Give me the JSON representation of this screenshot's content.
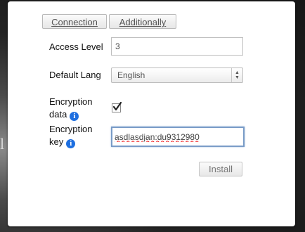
{
  "tabs": [
    {
      "label": "Connection"
    },
    {
      "label": "Additionally"
    }
  ],
  "form": {
    "access_level": {
      "label": "Access Level",
      "value": "3"
    },
    "default_lang": {
      "label": "Default Lang",
      "value": "English"
    },
    "encryption_data": {
      "label_line1": "Encryption",
      "label_line2": "data",
      "checked": true
    },
    "encryption_key": {
      "label_line1": "Encryption",
      "label_line2": "key",
      "value": "asdlasdjan:du9312980"
    }
  },
  "install_button": "Install",
  "background_glyph": "l",
  "icons": {
    "info": "info-icon",
    "checkmark": "checkmark-icon",
    "select_arrows": "select-arrows-icon"
  },
  "colors": {
    "info_icon": "#1e6fe0",
    "focus_border": "#7a9cc7"
  }
}
